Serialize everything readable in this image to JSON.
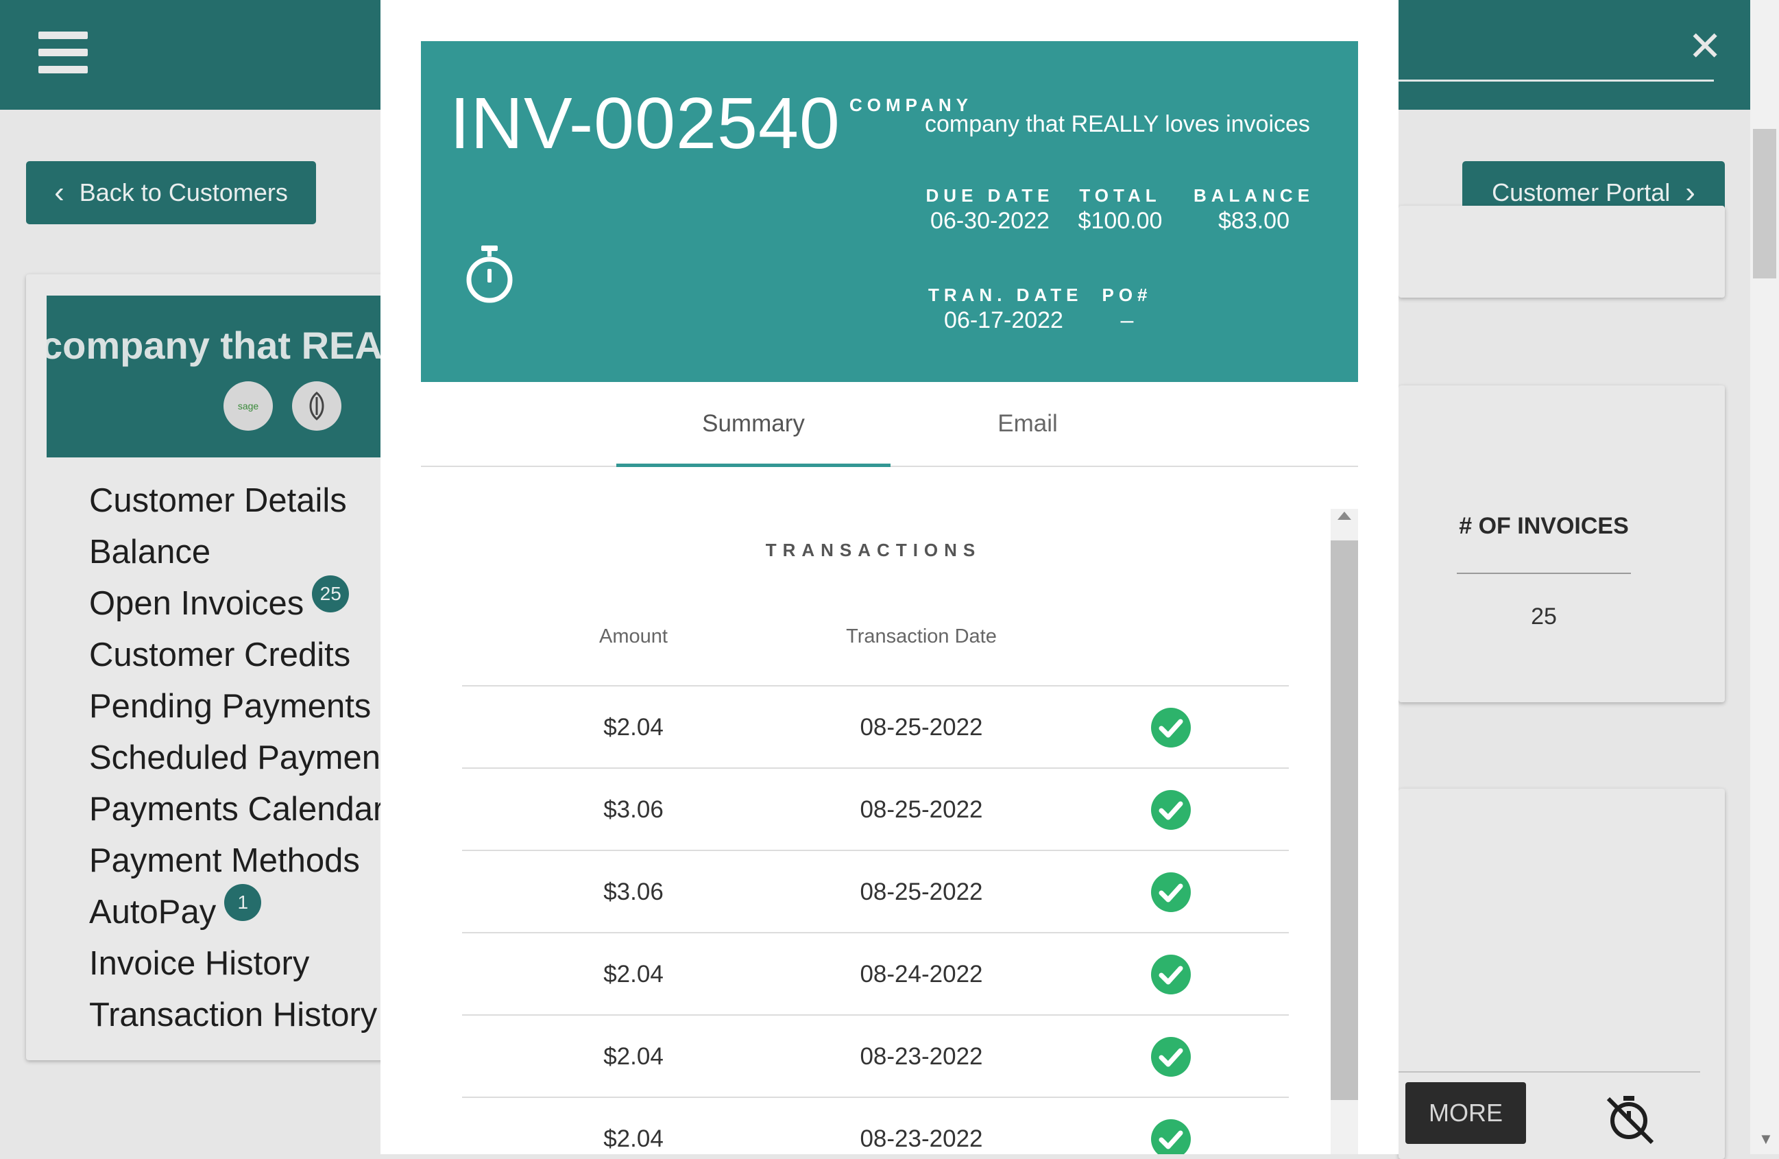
{
  "background": {
    "back_button_label": "Back to Customers",
    "portal_button_label": "Customer Portal",
    "customer_name": "company that REALLY loves invoices",
    "integration_icons": [
      "sage-intacct-icon",
      "quickbooks-icon"
    ],
    "nav": [
      {
        "label": "Customer Details",
        "badge": null
      },
      {
        "label": "Balance",
        "badge": null
      },
      {
        "label": "Open Invoices",
        "badge": "25"
      },
      {
        "label": "Customer Credits",
        "badge": null
      },
      {
        "label": "Pending Payments",
        "badge": null
      },
      {
        "label": "Scheduled Payments",
        "badge": null
      },
      {
        "label": "Payments Calendar",
        "badge": null
      },
      {
        "label": "Payment Methods",
        "badge": null
      },
      {
        "label": "AutoPay",
        "badge": "1"
      },
      {
        "label": "Invoice History",
        "badge": null
      },
      {
        "label": "Transaction History",
        "badge": null
      }
    ],
    "invoices_card": {
      "heading": "# OF INVOICES",
      "value": "25"
    },
    "more_button_label": "MORE"
  },
  "modal": {
    "invoice_number": "INV-002540",
    "company_label": "COMPANY",
    "company_value": "company that REALLY loves invoices",
    "due_date_label": "DUE DATE",
    "due_date_value": "06-30-2022",
    "total_label": "TOTAL",
    "total_value": "$100.00",
    "balance_label": "BALANCE",
    "balance_value": "$83.00",
    "tran_date_label": "TRAN. DATE",
    "tran_date_value": "06-17-2022",
    "po_label": "PO#",
    "po_value": "–",
    "tabs": [
      {
        "label": "Summary",
        "active": true
      },
      {
        "label": "Email",
        "active": false
      }
    ],
    "transactions": {
      "title": "TRANSACTIONS",
      "columns": [
        "Amount",
        "Transaction Date"
      ],
      "rows": [
        {
          "amount": "$2.04",
          "date": "08-25-2022",
          "status": "success-check-icon"
        },
        {
          "amount": "$3.06",
          "date": "08-25-2022",
          "status": "success-check-icon"
        },
        {
          "amount": "$3.06",
          "date": "08-25-2022",
          "status": "success-check-icon"
        },
        {
          "amount": "$2.04",
          "date": "08-24-2022",
          "status": "success-check-icon"
        },
        {
          "amount": "$2.04",
          "date": "08-23-2022",
          "status": "success-check-icon"
        },
        {
          "amount": "$2.04",
          "date": "08-23-2022",
          "status": "success-check-icon"
        }
      ]
    }
  },
  "colors": {
    "brand_dark": "#256d6b",
    "brand": "#339794",
    "success": "#2db36b"
  }
}
